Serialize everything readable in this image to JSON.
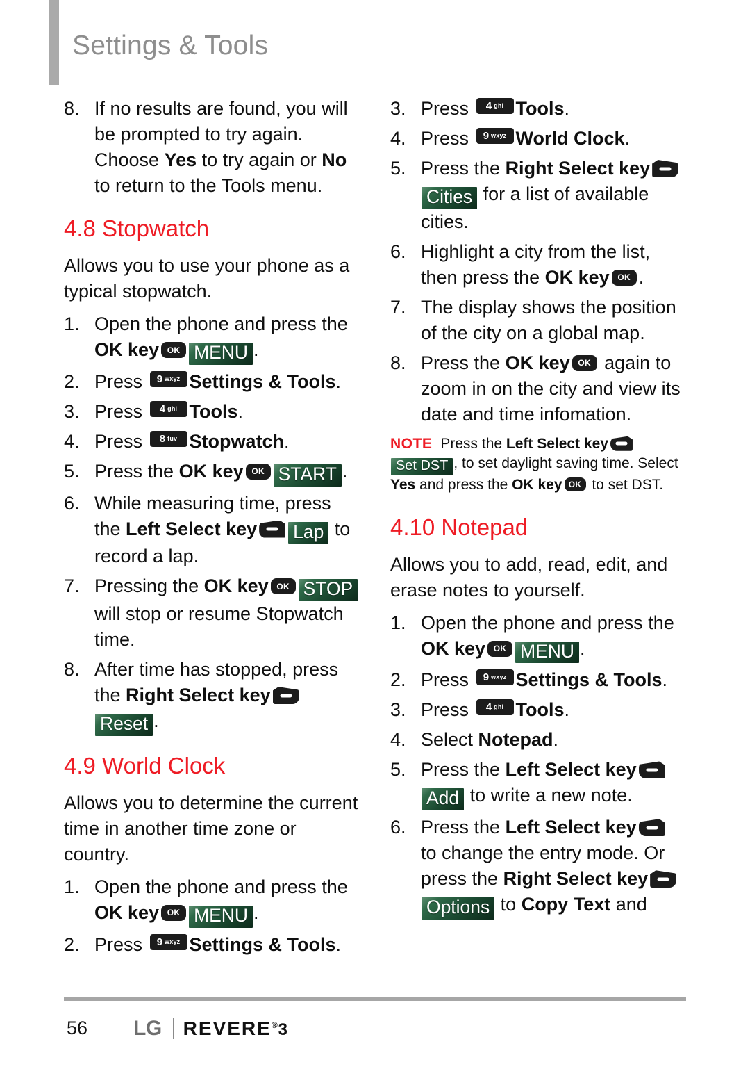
{
  "header": {
    "title": "Settings & Tools"
  },
  "left_column": {
    "step8_carryover": {
      "num": "8.",
      "parts": [
        {
          "t": "If no results are found, you will be prompted to try again. Choose "
        },
        {
          "t": "Yes",
          "bold": true
        },
        {
          "t": " to try again or "
        },
        {
          "t": "No",
          "bold": true
        },
        {
          "t": " to return to the Tools menu."
        }
      ]
    },
    "section_stopwatch": {
      "heading": "4.8 Stopwatch",
      "intro": "Allows you to use your phone as a typical stopwatch.",
      "steps": [
        {
          "num": "1.",
          "text_a": "Open the phone and press the ",
          "bold_a": "OK key",
          "okkey": "OK",
          "badge": "MENU",
          "text_b": "."
        },
        {
          "num": "2.",
          "text_a": "Press ",
          "numkey_digit": "9",
          "numkey_letters": "wxyz",
          "bold_b": "Settings & Tools",
          "text_b": "."
        },
        {
          "num": "3.",
          "text_a": "Press ",
          "numkey_digit": "4",
          "numkey_letters": "ghi",
          "bold_b": "Tools",
          "text_b": "."
        },
        {
          "num": "4.",
          "text_a": "Press ",
          "numkey_digit": "8",
          "numkey_letters": "tuv",
          "bold_b": "Stopwatch",
          "text_b": "."
        },
        {
          "num": "5.",
          "text_a": "Press the ",
          "bold_a": "OK key",
          "okkey": "OK",
          "badge": "START",
          "text_b": "."
        },
        {
          "num": "6.",
          "text_a": "While measuring time, press the ",
          "bold_a": "Left Select key",
          "selkey": "left",
          "badge": "Lap",
          "text_b": " to record a lap."
        },
        {
          "num": "7.",
          "text_a": "Pressing the ",
          "bold_a": "OK key",
          "okkey": "OK",
          "badge": "STOP",
          "text_b": " will stop or resume Stopwatch time."
        },
        {
          "num": "8.",
          "text_a": "After time has stopped, press the ",
          "bold_a": "Right Select key",
          "selkey": "right",
          "badge": "Reset",
          "text_b": "."
        }
      ]
    },
    "section_worldclock": {
      "heading": "4.9 World Clock",
      "intro": "Allows you to determine the current time in another time zone or country.",
      "steps": [
        {
          "num": "1.",
          "text_a": "Open the phone and press the ",
          "bold_a": "OK key",
          "okkey": "OK",
          "badge": "MENU",
          "text_b": "."
        },
        {
          "num": "2.",
          "text_a": "Press ",
          "numkey_digit": "9",
          "numkey_letters": "wxyz",
          "bold_b": "Settings & Tools",
          "text_b": "."
        }
      ]
    }
  },
  "right_column": {
    "worldclock_steps": [
      {
        "num": "3.",
        "text_a": "Press ",
        "numkey_digit": "4",
        "numkey_letters": "ghi",
        "bold_b": "Tools",
        "text_b": "."
      },
      {
        "num": "4.",
        "text_a": "Press ",
        "numkey_digit": "9",
        "numkey_letters": "wxyz",
        "bold_b": "World Clock",
        "text_b": "."
      },
      {
        "num": "5.",
        "text_a": "Press the ",
        "bold_a": "Right Select key",
        "selkey": "right",
        "badge": "Cities",
        "text_b": " for a list of available cities."
      },
      {
        "num": "6.",
        "text_a": "Highlight a city from the list, then press the ",
        "bold_a": "OK key",
        "okkey": "OK",
        "text_b": "."
      },
      {
        "num": "7.",
        "text_a": "The display shows the position of the city on a global map.",
        "text_b": ""
      },
      {
        "num": "8.",
        "text_a": "Press the ",
        "bold_a": "OK key",
        "okkey": "OK",
        "text_b": " again to zoom in on the city and view its date and time infomation."
      }
    ],
    "note": {
      "label": "NOTE",
      "part1": "Press the ",
      "bold1": "Left Select key",
      "selkey": "left",
      "badge": "Set DST",
      "part2": ", to set daylight saving time. Select ",
      "bold2": "Yes",
      "part3": " and press the ",
      "bold3": "OK key",
      "okkey": "OK",
      "part4": " to set DST."
    },
    "section_notepad": {
      "heading": "4.10 Notepad",
      "intro": "Allows you to add, read, edit, and erase notes to yourself.",
      "steps": [
        {
          "num": "1.",
          "text_a": "Open the phone and press the ",
          "bold_a": "OK key",
          "okkey": "OK",
          "badge": "MENU",
          "text_b": "."
        },
        {
          "num": "2.",
          "text_a": "Press ",
          "numkey_digit": "9",
          "numkey_letters": "wxyz",
          "bold_b": "Settings & Tools",
          "text_b": "."
        },
        {
          "num": "3.",
          "text_a": "Press ",
          "numkey_digit": "4",
          "numkey_letters": "ghi",
          "bold_b": "Tools",
          "text_b": "."
        },
        {
          "num": "4.",
          "text_a": "Select ",
          "bold_b": "Notepad",
          "text_b": "."
        },
        {
          "num": "5.",
          "text_a": "Press the ",
          "bold_a": "Left Select key",
          "selkey": "left",
          "badge": "Add",
          "text_b": " to write a new note."
        },
        {
          "num": "6.",
          "text_a": "Press the ",
          "bold_a": "Left Select key",
          "selkey": "left",
          "text_mid": " to change the entry mode. Or press the ",
          "bold_mid": "Right Select key",
          "selkey2": "right",
          "badge": "Options",
          "text_c": " to ",
          "bold_c": "Copy Text",
          "text_b": " and"
        }
      ]
    }
  },
  "footer": {
    "page_number": "56",
    "lg_wordmark": "LG",
    "product": "REVERE",
    "registered": "®",
    "model_number": "3"
  },
  "colors": {
    "accent_red": "#ee1c25",
    "header_gray": "#8e8e8e",
    "badge_green_dark": "#0d2a1b",
    "badge_green_light": "#5f8f72",
    "key_black": "#1c1c1c",
    "lg_magenta": "#cf1b8d"
  }
}
